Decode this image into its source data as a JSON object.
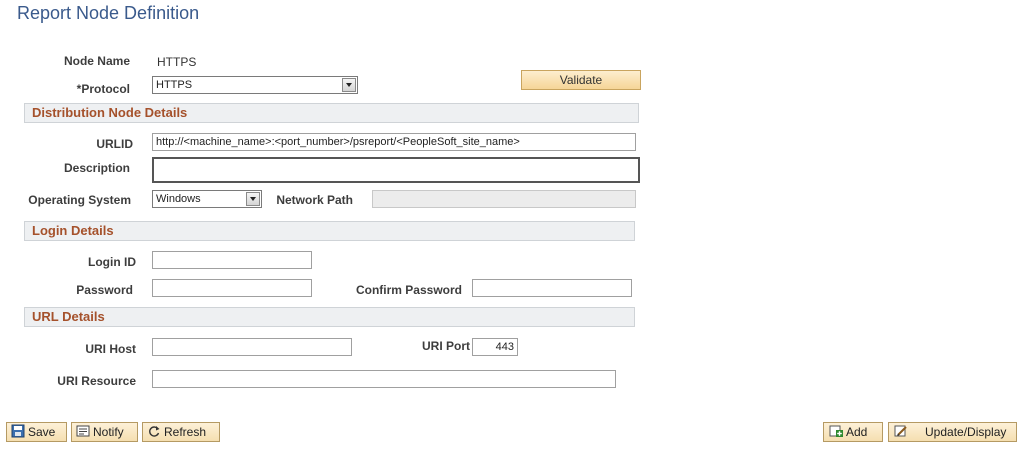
{
  "page": {
    "title": "Report Node Definition"
  },
  "node": {
    "name_label": "Node Name",
    "name_value": "HTTPS"
  },
  "protocol": {
    "label": "*Protocol",
    "value": "HTTPS"
  },
  "validate_label": "Validate",
  "distribution": {
    "header": "Distribution Node Details",
    "urlid_label": "URLID",
    "urlid_value": "http://<machine_name>:<port_number>/psreport/<PeopleSoft_site_name>",
    "description_label": "Description",
    "description_value": "",
    "os_label": "Operating System",
    "os_value": "Windows",
    "network_path_label": "Network Path",
    "network_path_value": ""
  },
  "login": {
    "header": "Login Details",
    "login_id_label": "Login ID",
    "password_label": "Password",
    "confirm_password_label": "Confirm Password"
  },
  "url": {
    "header": "URL Details",
    "host_label": "URI Host",
    "port_label": "URI Port",
    "port_value": "443",
    "resource_label": "URI Resource"
  },
  "toolbar": {
    "save": "Save",
    "notify": "Notify",
    "refresh": "Refresh",
    "add": "Add",
    "update_display": "Update/Display"
  }
}
